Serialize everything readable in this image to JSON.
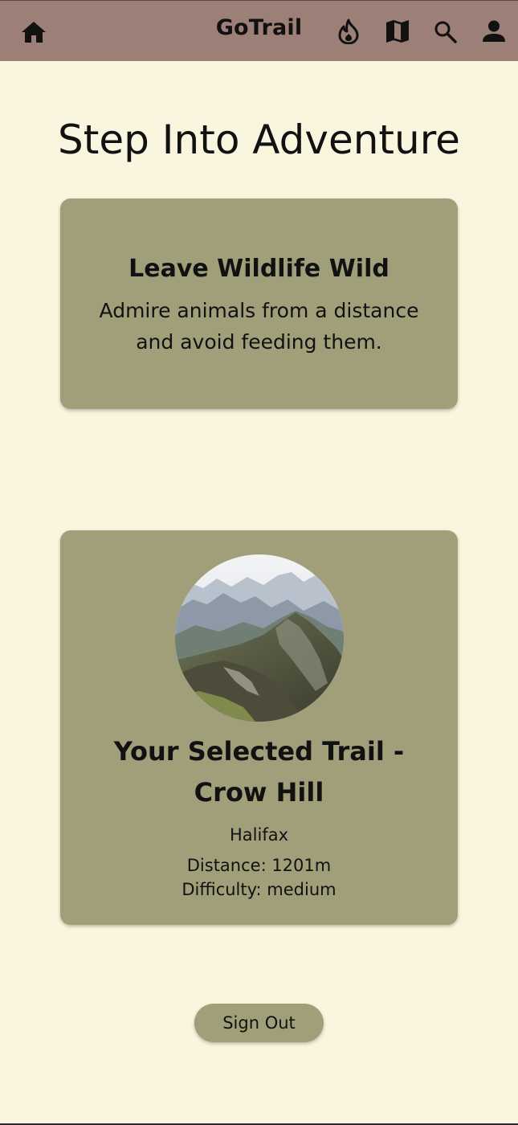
{
  "app": {
    "brand": "GoTrail"
  },
  "nav": {
    "icons": [
      "home-icon",
      "fire-icon",
      "map-icon",
      "search-icon",
      "person-icon"
    ]
  },
  "page": {
    "title": "Step Into Adventure"
  },
  "tip": {
    "title": "Leave Wildlife Wild",
    "text": "Admire animals from a distance and avoid feeding them."
  },
  "trail": {
    "title": "Your Selected Trail - Crow Hill",
    "location": "Halifax",
    "distance": "Distance: 1201m",
    "difficulty": "Difficulty: medium"
  },
  "actions": {
    "sign_out_label": "Sign Out"
  },
  "colors": {
    "navbar": "#9c8078",
    "background": "#faf5df",
    "card": "#a09f7a"
  }
}
